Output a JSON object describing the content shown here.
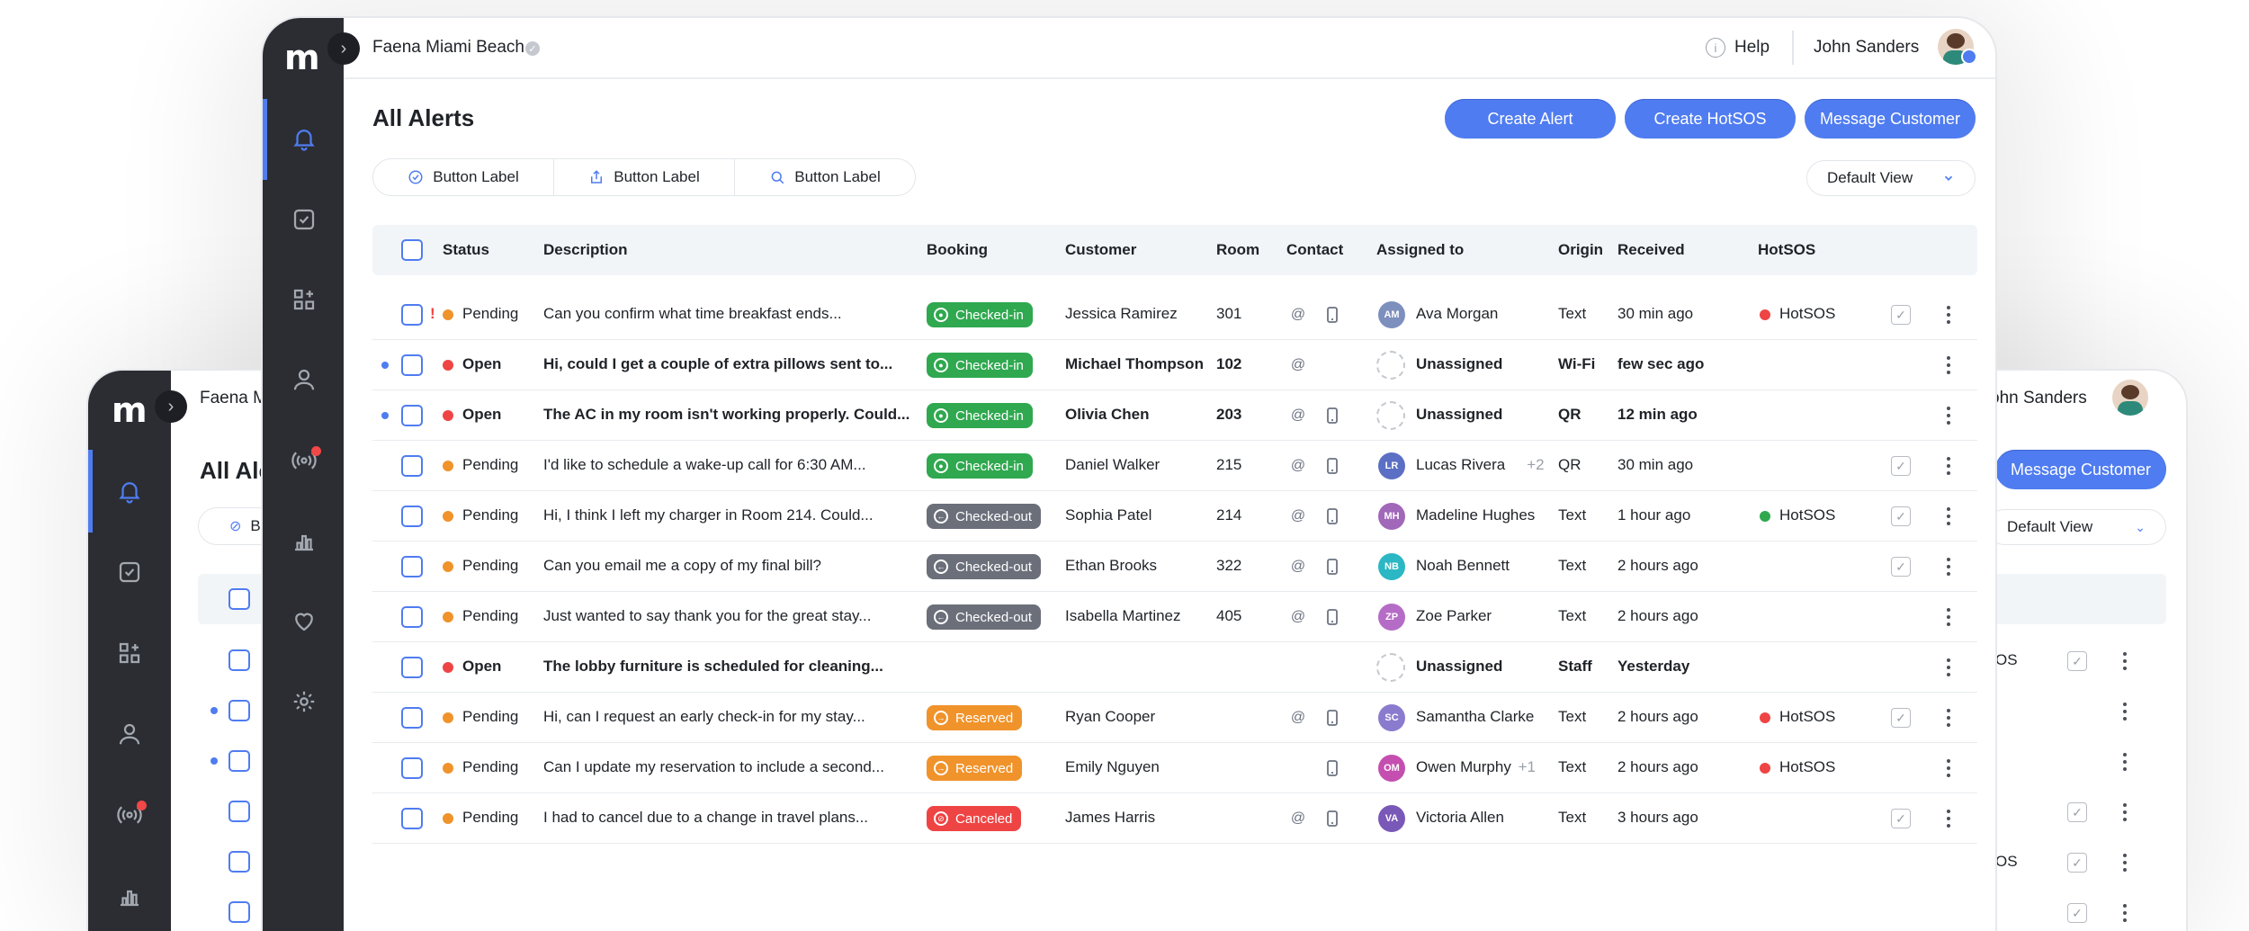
{
  "brand": {
    "logo": "m",
    "collapse": "›"
  },
  "colors": {
    "accent": "#4f7cf0",
    "pending": "#f0932b",
    "open": "#ef4444",
    "checked_in": "#2fa84f",
    "checked_out": "#6b6f7a",
    "reserved": "#f0932b",
    "canceled": "#ef4444",
    "hotsos_red": "#ef4444",
    "hotsos_green": "#2fa84f"
  },
  "header": {
    "property": "Faena Miami Beach",
    "help": "Help",
    "user": "John Sanders"
  },
  "back_window": {
    "property": "Faena M",
    "user": "ohn Sanders",
    "title": "All Ale",
    "seg_label": "B",
    "message_button": "Message Customer",
    "default_view": "Default View",
    "row_hotsos": [
      "OS",
      "OS"
    ]
  },
  "page": {
    "title": "All Alerts"
  },
  "actions": {
    "create_alert": "Create Alert",
    "create_hotsos": "Create HotSOS",
    "message_customer": "Message Customer"
  },
  "segments": [
    {
      "label": "Button Label",
      "icon": "check-circle-icon"
    },
    {
      "label": "Button Label",
      "icon": "share-icon"
    },
    {
      "label": "Button Label",
      "icon": "search-icon"
    }
  ],
  "view_select": {
    "value": "Default View"
  },
  "columns": [
    "Status",
    "Description",
    "Booking",
    "Customer",
    "Room",
    "Contact",
    "Assigned to",
    "Origin",
    "Received",
    "HotSOS"
  ],
  "rows": [
    {
      "status": "Pending",
      "flag": "!",
      "desc": "Can you confirm what time breakfast ends...",
      "booking": "Checked-in",
      "customer": "Jessica Ramirez",
      "room": "301",
      "at": true,
      "phone": true,
      "avatar": "AM",
      "assignee": "Ava Morgan",
      "extra": "",
      "origin": "Text",
      "received": "30 min ago",
      "hotsos": "HotSOS",
      "hotsos_color": "red",
      "done": true,
      "unread": false
    },
    {
      "status": "Open",
      "flag": "",
      "desc": "Hi, could I get a couple of extra pillows sent to...",
      "booking": "Checked-in",
      "customer": "Michael Thompson",
      "room": "102",
      "at": true,
      "phone": false,
      "avatar": "",
      "assignee": "Unassigned",
      "extra": "",
      "origin": "Wi-Fi",
      "received": "few sec ago",
      "hotsos": "",
      "hotsos_color": "",
      "done": false,
      "unread": true
    },
    {
      "status": "Open",
      "flag": "",
      "desc": "The AC in my room isn't working properly. Could...",
      "booking": "Checked-in",
      "customer": "Olivia Chen",
      "room": "203",
      "at": true,
      "phone": true,
      "avatar": "",
      "assignee": "Unassigned",
      "extra": "",
      "origin": "QR",
      "received": "12 min ago",
      "hotsos": "",
      "hotsos_color": "",
      "done": false,
      "unread": true
    },
    {
      "status": "Pending",
      "flag": "",
      "desc": "I'd like to schedule a wake-up call for 6:30 AM...",
      "booking": "Checked-in",
      "customer": "Daniel Walker",
      "room": "215",
      "at": true,
      "phone": true,
      "avatar": "LR",
      "assignee": "Lucas Rivera",
      "extra": "+2",
      "origin": "QR",
      "received": "30 min ago",
      "hotsos": "",
      "hotsos_color": "",
      "done": true,
      "unread": false
    },
    {
      "status": "Pending",
      "flag": "",
      "desc": "Hi, I think I left my charger in Room 214. Could...",
      "booking": "Checked-out",
      "customer": "Sophia Patel",
      "room": "214",
      "at": true,
      "phone": true,
      "avatar": "MH",
      "assignee": "Madeline Hughes",
      "extra": "",
      "origin": "Text",
      "received": "1 hour ago",
      "hotsos": "HotSOS",
      "hotsos_color": "green",
      "done": true,
      "unread": false
    },
    {
      "status": "Pending",
      "flag": "",
      "desc": "Can you email me a copy of my final bill?",
      "booking": "Checked-out",
      "customer": "Ethan Brooks",
      "room": "322",
      "at": true,
      "phone": true,
      "avatar": "NB",
      "assignee": "Noah Bennett",
      "extra": "",
      "origin": "Text",
      "received": "2 hours ago",
      "hotsos": "",
      "hotsos_color": "",
      "done": true,
      "unread": false
    },
    {
      "status": "Pending",
      "flag": "",
      "desc": "Just wanted to say thank you for the great stay...",
      "booking": "Checked-out",
      "customer": "Isabella Martinez",
      "room": "405",
      "at": true,
      "phone": true,
      "avatar": "ZP",
      "assignee": "Zoe Parker",
      "extra": "",
      "origin": "Text",
      "received": "2 hours ago",
      "hotsos": "",
      "hotsos_color": "",
      "done": false,
      "unread": false
    },
    {
      "status": "Open",
      "flag": "",
      "desc": "The lobby furniture is scheduled for cleaning...",
      "booking": "",
      "customer": "",
      "room": "",
      "at": false,
      "phone": false,
      "avatar": "",
      "assignee": "Unassigned",
      "extra": "",
      "origin": "Staff",
      "received": "Yesterday",
      "hotsos": "",
      "hotsos_color": "",
      "done": false,
      "unread": false
    },
    {
      "status": "Pending",
      "flag": "",
      "desc": "Hi, can I request an early check-in for my stay...",
      "booking": "Reserved",
      "customer": "Ryan Cooper",
      "room": "",
      "at": true,
      "phone": true,
      "avatar": "SC",
      "assignee": "Samantha Clarke",
      "extra": "",
      "origin": "Text",
      "received": "2 hours ago",
      "hotsos": "HotSOS",
      "hotsos_color": "red",
      "done": true,
      "unread": false
    },
    {
      "status": "Pending",
      "flag": "",
      "desc": "Can I update my reservation to include a second...",
      "booking": "Reserved",
      "customer": "Emily Nguyen",
      "room": "",
      "at": false,
      "phone": true,
      "avatar": "OM",
      "assignee": "Owen Murphy",
      "extra": "+1",
      "origin": "Text",
      "received": "2 hours ago",
      "hotsos": "HotSOS",
      "hotsos_color": "red",
      "done": false,
      "unread": false
    },
    {
      "status": "Pending",
      "flag": "",
      "desc": "I had to cancel due to a change in travel plans...",
      "booking": "Canceled",
      "customer": "James Harris",
      "room": "",
      "at": true,
      "phone": true,
      "avatar": "VA",
      "assignee": "Victoria Allen",
      "extra": "",
      "origin": "Text",
      "received": "3 hours ago",
      "hotsos": "",
      "hotsos_color": "",
      "done": true,
      "unread": false
    }
  ]
}
